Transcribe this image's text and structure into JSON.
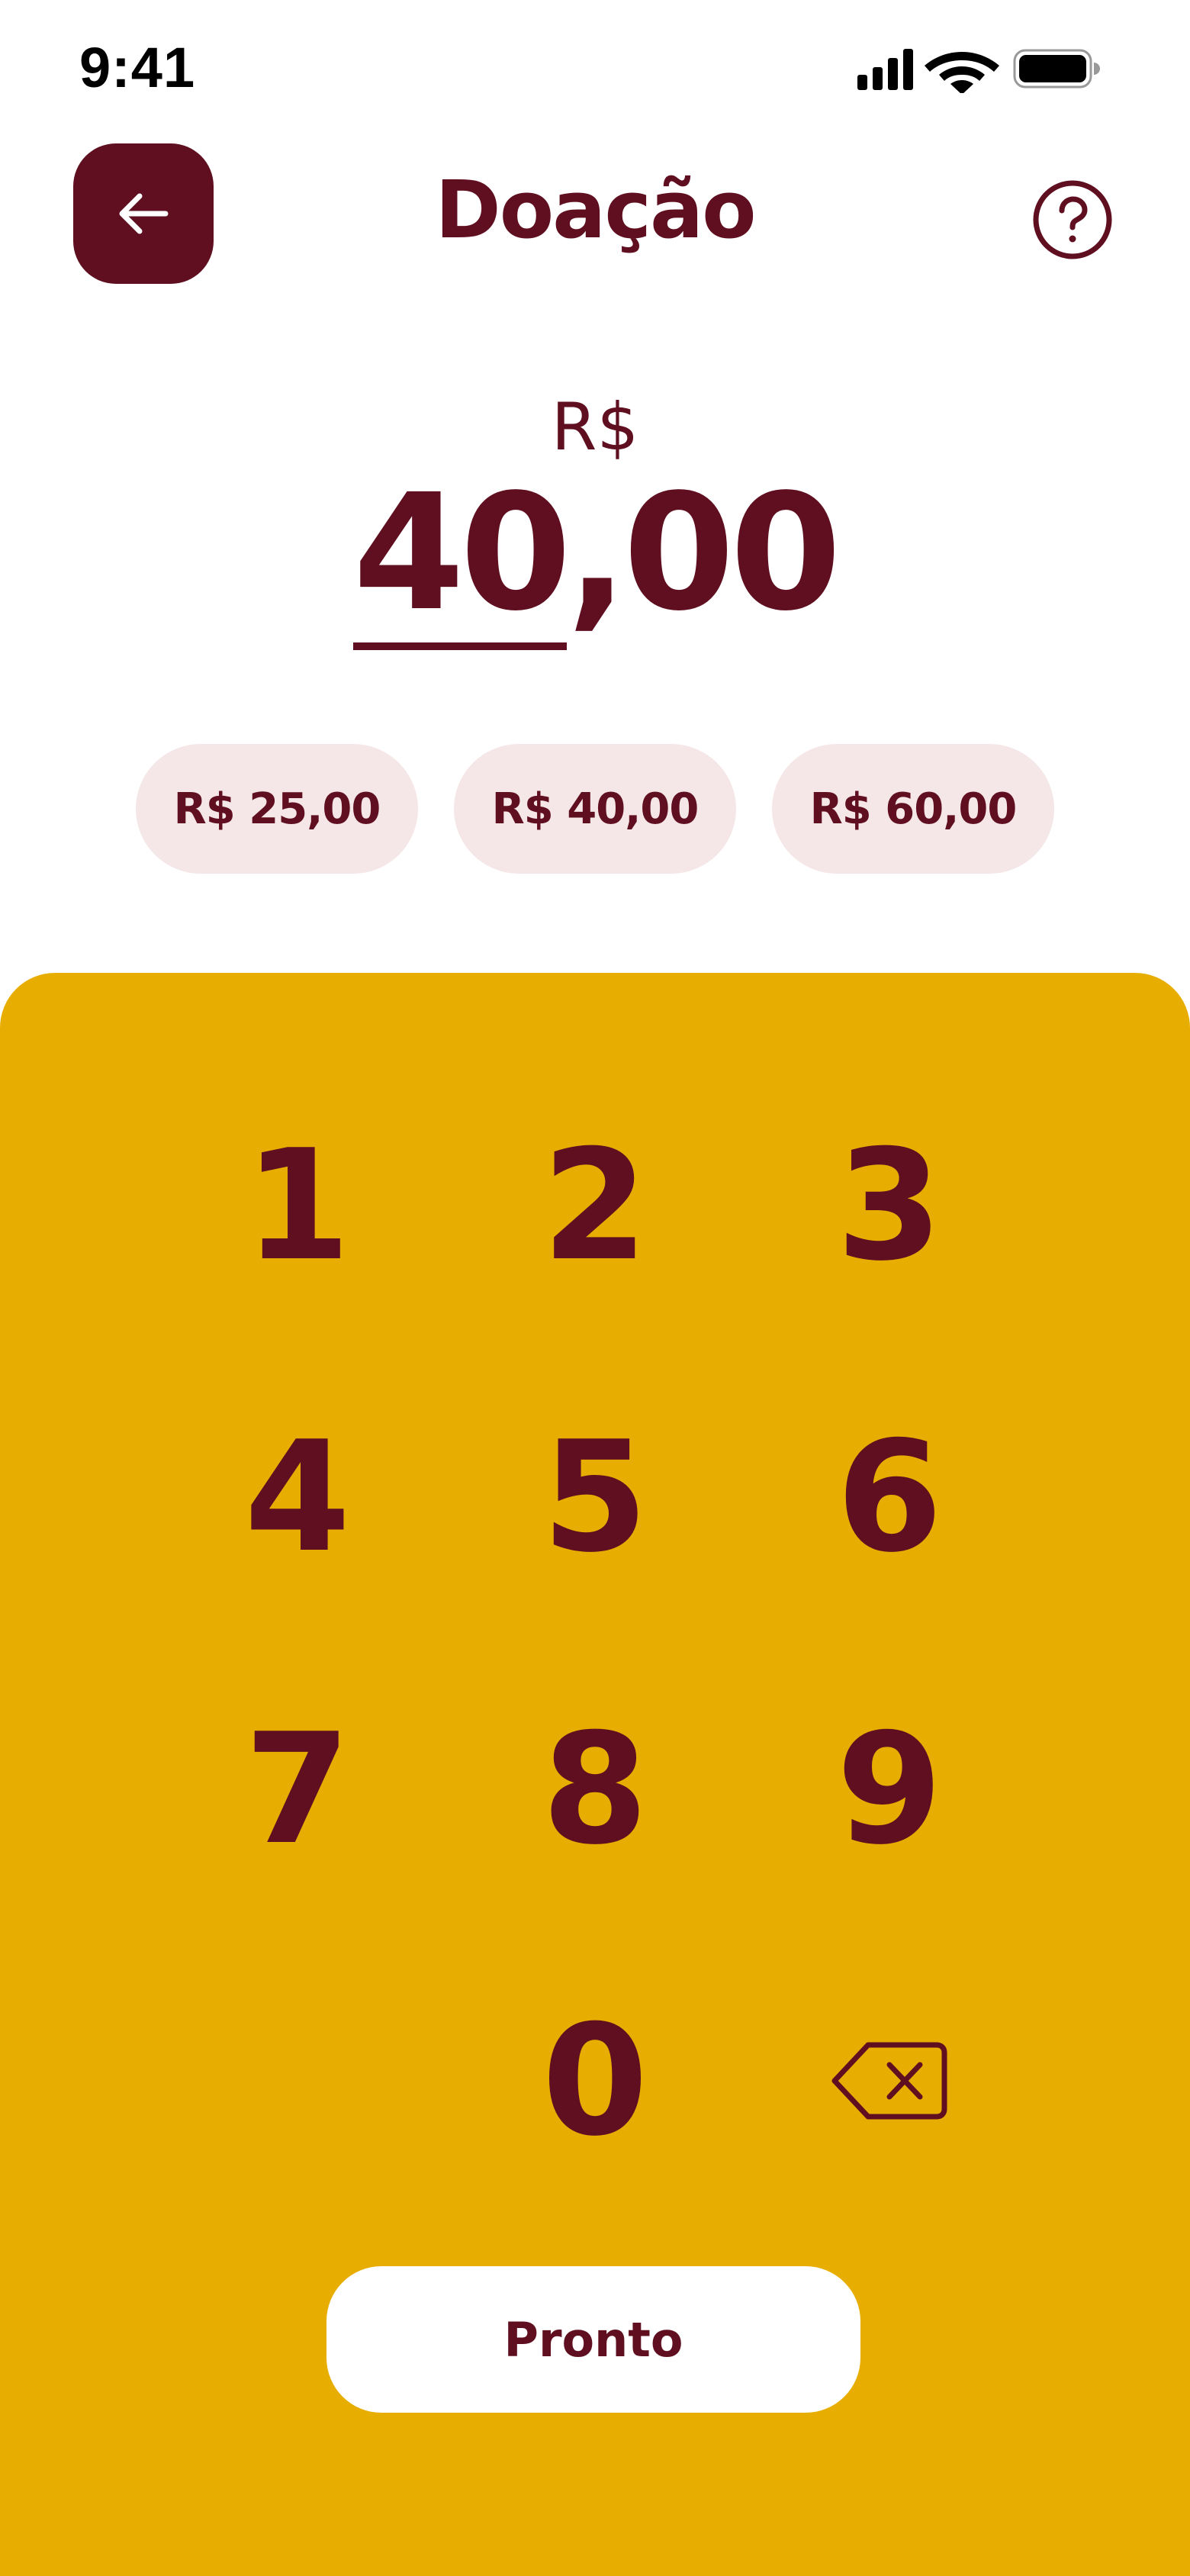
{
  "status_bar": {
    "time": "9:41",
    "icons": [
      "signal-icon",
      "wifi-icon",
      "battery-icon"
    ]
  },
  "header": {
    "title": "Doação",
    "back_icon": "arrow-left-icon",
    "help_icon": "question-circle-icon"
  },
  "amount": {
    "currency": "R$",
    "integer_part": "40",
    "decimal_part": ",00"
  },
  "quick_amounts": [
    {
      "label": "R$ 25,00"
    },
    {
      "label": "R$ 40,00"
    },
    {
      "label": "R$ 60,00"
    }
  ],
  "keypad": {
    "keys": [
      "1",
      "2",
      "3",
      "4",
      "5",
      "6",
      "7",
      "8",
      "9",
      "0"
    ],
    "backspace_icon": "backspace-icon",
    "done_label": "Pronto"
  },
  "colors": {
    "primary": "#5f0f1f",
    "keypad_background": "#e8ad01",
    "chip_background": "#f5e6e7",
    "page_background": "#ffffff"
  }
}
